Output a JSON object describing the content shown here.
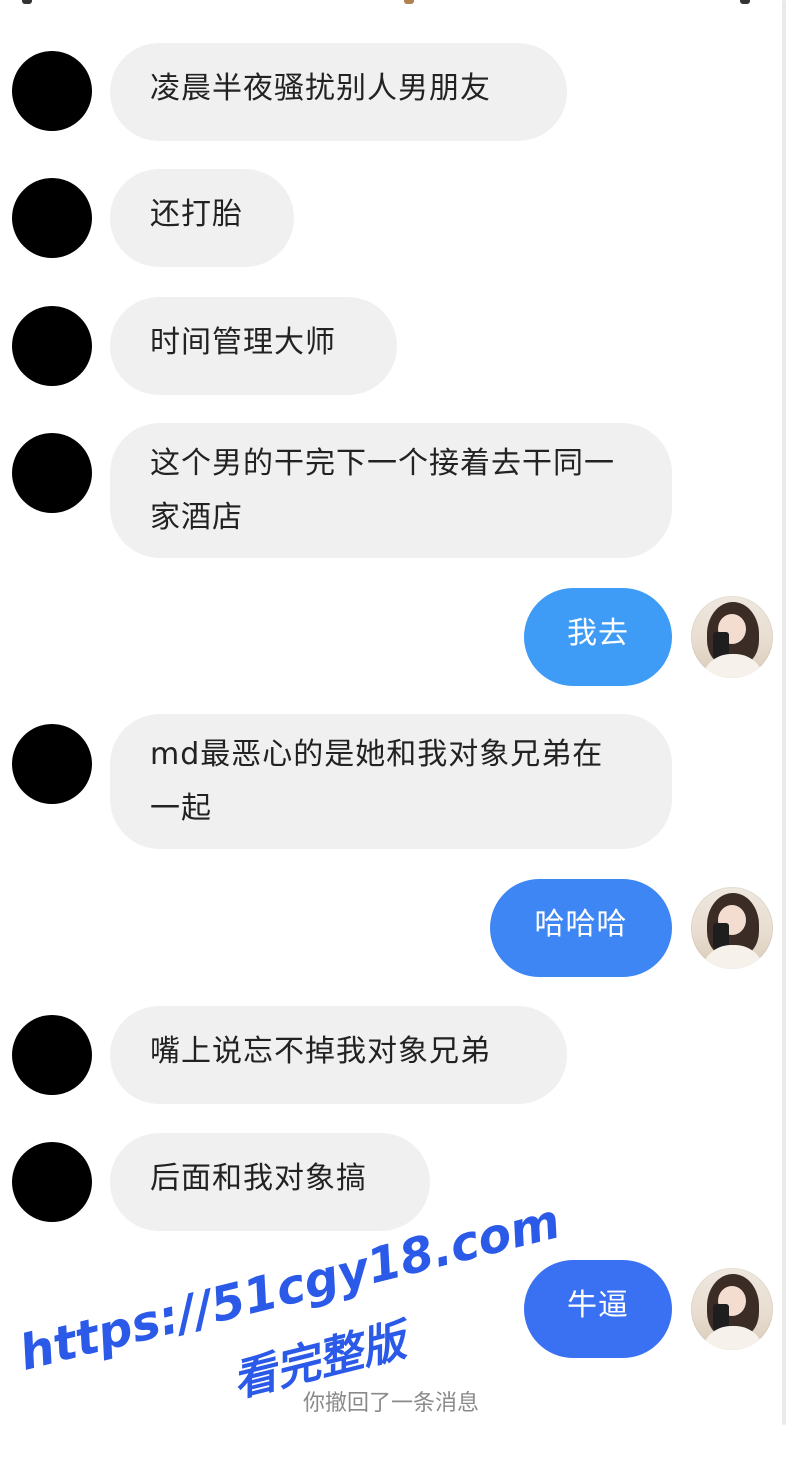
{
  "messages": [
    {
      "side": "in",
      "text": "凌晨半夜骚扰别人男朋友"
    },
    {
      "side": "in",
      "text": "还打胎"
    },
    {
      "side": "in",
      "text": "时间管理大师"
    },
    {
      "side": "in",
      "text": "这个男的干完下一个接着去干同一家酒店"
    },
    {
      "side": "out",
      "text": "我去"
    },
    {
      "side": "in",
      "text": "md最恶心的是她和我对象兄弟在一起"
    },
    {
      "side": "out",
      "text": "哈哈哈"
    },
    {
      "side": "in",
      "text": "嘴上说忘不掉我对象兄弟"
    },
    {
      "side": "in",
      "text": "后面和我对象搞"
    },
    {
      "side": "out",
      "text": "牛逼"
    }
  ],
  "system_notice": "你撤回了一条消息",
  "watermark": {
    "url": "https://51cgy18.com",
    "caption": "看完整版"
  },
  "colors": {
    "incoming_bubble": "#f0f0f0",
    "outgoing_bubble_light": "#3e9cf7",
    "outgoing_bubble_mid": "#3d86f3",
    "outgoing_bubble_dark": "#3a70f2",
    "watermark": "#2b5ae8"
  },
  "icons": {
    "contact_avatar": "blacked-out-avatar",
    "self_avatar": "girl-photo-avatar"
  }
}
